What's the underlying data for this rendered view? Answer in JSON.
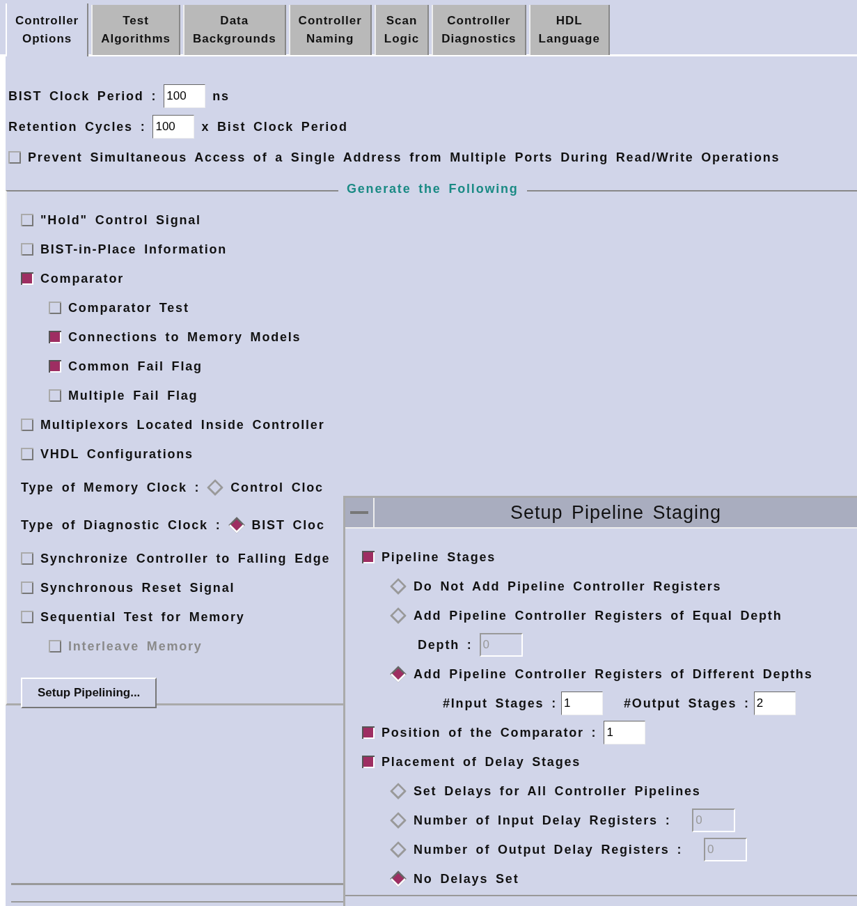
{
  "tabs": [
    {
      "label": "Controller\nOptions",
      "selected": true
    },
    {
      "label": "Test\nAlgorithms",
      "selected": false
    },
    {
      "label": "Data\nBackgrounds",
      "selected": false
    },
    {
      "label": "Controller\nNaming",
      "selected": false
    },
    {
      "label": "Scan\nLogic",
      "selected": false
    },
    {
      "label": "Controller\nDiagnostics",
      "selected": false
    },
    {
      "label": "HDL\nLanguage",
      "selected": false
    }
  ],
  "settings": [
    {
      "kind": "field",
      "label": "BIST Clock Period :",
      "field": {
        "value": "100",
        "disabled": false
      },
      "unit": "ns"
    },
    {
      "kind": "field",
      "label": "Retention Cycles :",
      "field": {
        "value": "100",
        "disabled": false
      },
      "unit": "x Bist Clock Period"
    },
    {
      "kind": "checkbox",
      "label": "Prevent Simultaneous Access of a Single Address from Multiple Ports During Read/Write Operations",
      "checked": false,
      "disabled": false
    }
  ],
  "generate": {
    "title": "Generate the Following",
    "items": [
      {
        "kind": "checkbox",
        "label": "\"Hold\" Control Signal",
        "checked": false,
        "disabled": false
      },
      {
        "kind": "checkbox",
        "label": "BIST-in-Place Information",
        "checked": false,
        "disabled": false
      },
      {
        "kind": "checkbox",
        "label": "Comparator",
        "checked": true,
        "disabled": false,
        "children": [
          {
            "kind": "checkbox",
            "label": "Comparator Test",
            "checked": false,
            "disabled": false
          },
          {
            "kind": "checkbox",
            "label": "Connections to Memory Models",
            "checked": true,
            "disabled": false
          },
          {
            "kind": "checkbox",
            "label": "Common Fail Flag",
            "checked": true,
            "disabled": false
          },
          {
            "kind": "checkbox",
            "label": "Multiple Fail Flag",
            "checked": false,
            "disabled": false
          }
        ]
      },
      {
        "kind": "checkbox",
        "label": "Multiplexors Located Inside Controller",
        "checked": false,
        "disabled": false
      },
      {
        "kind": "checkbox",
        "label": "VHDL Configurations",
        "checked": false,
        "disabled": false
      },
      {
        "kind": "radio_group",
        "label": "Type of Memory Clock :",
        "options": [
          {
            "label": "Control Cloc",
            "selected": false
          }
        ]
      },
      {
        "kind": "radio_group",
        "label": "Type of Diagnostic Clock :",
        "options": [
          {
            "label": "BIST Cloc",
            "selected": true
          }
        ]
      },
      {
        "kind": "checkbox",
        "label": "Synchronize Controller to Falling Edge",
        "checked": false,
        "disabled": false
      },
      {
        "kind": "checkbox",
        "label": "Synchronous Reset Signal",
        "checked": false,
        "disabled": false
      },
      {
        "kind": "checkbox",
        "label": "Sequential Test for Memory",
        "checked": false,
        "disabled": false,
        "children": [
          {
            "kind": "checkbox",
            "label": "Interleave Memory",
            "checked": false,
            "disabled": true
          }
        ]
      },
      {
        "kind": "button",
        "label": "Setup Pipelining..."
      }
    ]
  },
  "dialog": {
    "title": "Setup Pipeline Staging",
    "items": [
      {
        "kind": "checkbox",
        "label": "Pipeline Stages",
        "checked": true,
        "disabled": false,
        "children": [
          {
            "kind": "radio",
            "label": "Do Not Add Pipeline Controller Registers",
            "selected": false
          },
          {
            "kind": "radio",
            "label": "Add Pipeline Controller Registers of Equal Depth",
            "selected": false,
            "children": [
              {
                "kind": "field",
                "label": "Depth :",
                "field": {
                  "value": "0",
                  "disabled": true
                }
              }
            ]
          },
          {
            "kind": "radio",
            "label": "Add Pipeline Controller Registers of Different Depths",
            "selected": true,
            "children": [
              {
                "kind": "fields",
                "fields": [
                  {
                    "label": "#Input Stages :",
                    "value": "1",
                    "disabled": false
                  },
                  {
                    "label": "#Output Stages :",
                    "value": "2",
                    "disabled": false
                  }
                ]
              }
            ]
          }
        ]
      },
      {
        "kind": "checkbox",
        "label": "Position of the Comparator :",
        "checked": true,
        "disabled": false,
        "field": {
          "value": "1",
          "disabled": false
        }
      },
      {
        "kind": "checkbox",
        "label": "Placement of Delay Stages",
        "checked": true,
        "disabled": false,
        "children": [
          {
            "kind": "radio",
            "label": "Set Delays for All Controller Pipelines",
            "selected": false
          },
          {
            "kind": "radio",
            "label": "Number of Input Delay Registers  :",
            "selected": false,
            "field": {
              "value": "0",
              "disabled": true
            }
          },
          {
            "kind": "radio",
            "label": "Number of Output Delay Registers :",
            "selected": false,
            "field": {
              "value": "0",
              "disabled": true
            }
          },
          {
            "kind": "radio",
            "label": "No Delays Set",
            "selected": true
          }
        ]
      }
    ]
  }
}
